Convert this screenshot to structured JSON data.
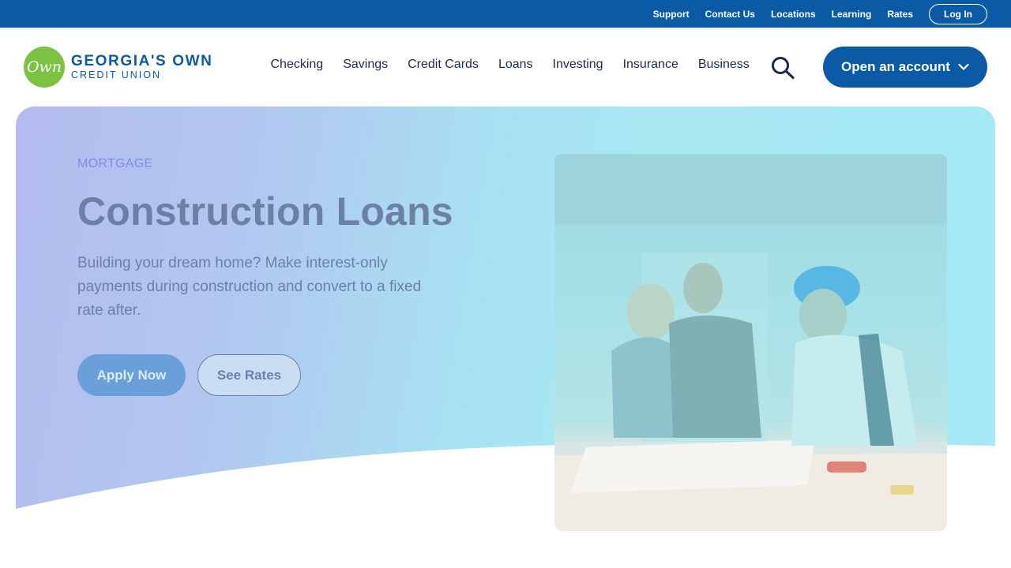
{
  "utility_bar": {
    "links": [
      "Support",
      "Contact Us",
      "Locations",
      "Learning",
      "Rates"
    ],
    "login_label": "Log In"
  },
  "header": {
    "logo": {
      "mark": "Own",
      "line1": "GEORGIA'S OWN",
      "line2": "CREDIT UNION",
      "brand_green": "#7cc242",
      "brand_blue": "#0b5aa6"
    },
    "nav": [
      "Checking",
      "Savings",
      "Credit Cards",
      "Loans",
      "Investing",
      "Insurance",
      "Business"
    ],
    "search_icon": "search-icon",
    "cta_label": "Open an account",
    "cta_icon": "chevron-down-icon"
  },
  "hero": {
    "eyebrow": "MORTGAGE",
    "title": "Construction Loans",
    "subtitle": "Building your dream home? Make interest-only payments during construction and convert to a fixed rate after.",
    "primary_label": "Apply Now",
    "secondary_label": "See Rates",
    "photo_subject": "construction-planning-photo",
    "colors": {
      "gradient_start": "#b4bbef",
      "gradient_end": "#a6e8f3"
    }
  }
}
